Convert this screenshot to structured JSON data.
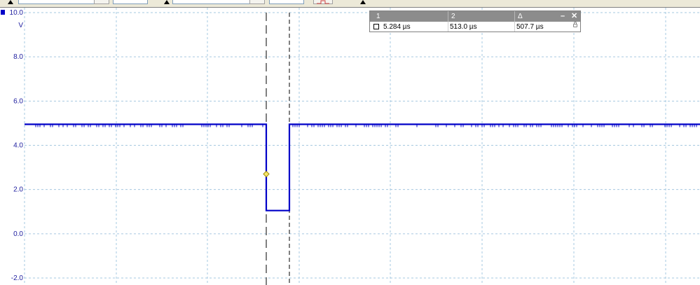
{
  "colors": {
    "trace": "#0000c8",
    "grid": "#a6c8e0",
    "axis_text": "#2020a0",
    "cursor_line": "#000000",
    "trigger_marker": "#f5e56b",
    "panel_header": "#8c8c8c"
  },
  "toolbar": {
    "icons": [
      "dropdown-arrow-icon",
      "dropdown-arrow-icon",
      "dropdown-arrow-icon",
      "trigger-mode-icon"
    ]
  },
  "scope": {
    "y_unit": "V",
    "y_ticks": [
      "10.0",
      "8.0",
      "6.0",
      "4.0",
      "2.0",
      "0.0",
      "-2.0"
    ]
  },
  "cursor_panel": {
    "col1_header": "1",
    "col2_header": "2",
    "delta_header": "Δ",
    "minimize_label": "–",
    "close_label": "✕",
    "value1": "5.284 µs",
    "value2": "513.0 µs",
    "delta_value": "507.7 µs"
  },
  "chart_data": {
    "type": "line",
    "title": "",
    "xlabel": "",
    "ylabel": "V",
    "ylim": [
      -2.0,
      10.0
    ],
    "y_ticks": [
      10.0,
      8.0,
      6.0,
      4.0,
      2.0,
      0.0,
      -2.0
    ],
    "grid": true,
    "cursors_us": [
      5.284,
      513.0
    ],
    "cursor_delta_us": 507.7,
    "trigger_level": 2.7,
    "series": [
      {
        "x_us": [
          -2200,
          0,
          0,
          513,
          513,
          7300
        ],
        "y": [
          4.95,
          4.95,
          1.05,
          1.05,
          4.95,
          4.95
        ]
      }
    ]
  }
}
